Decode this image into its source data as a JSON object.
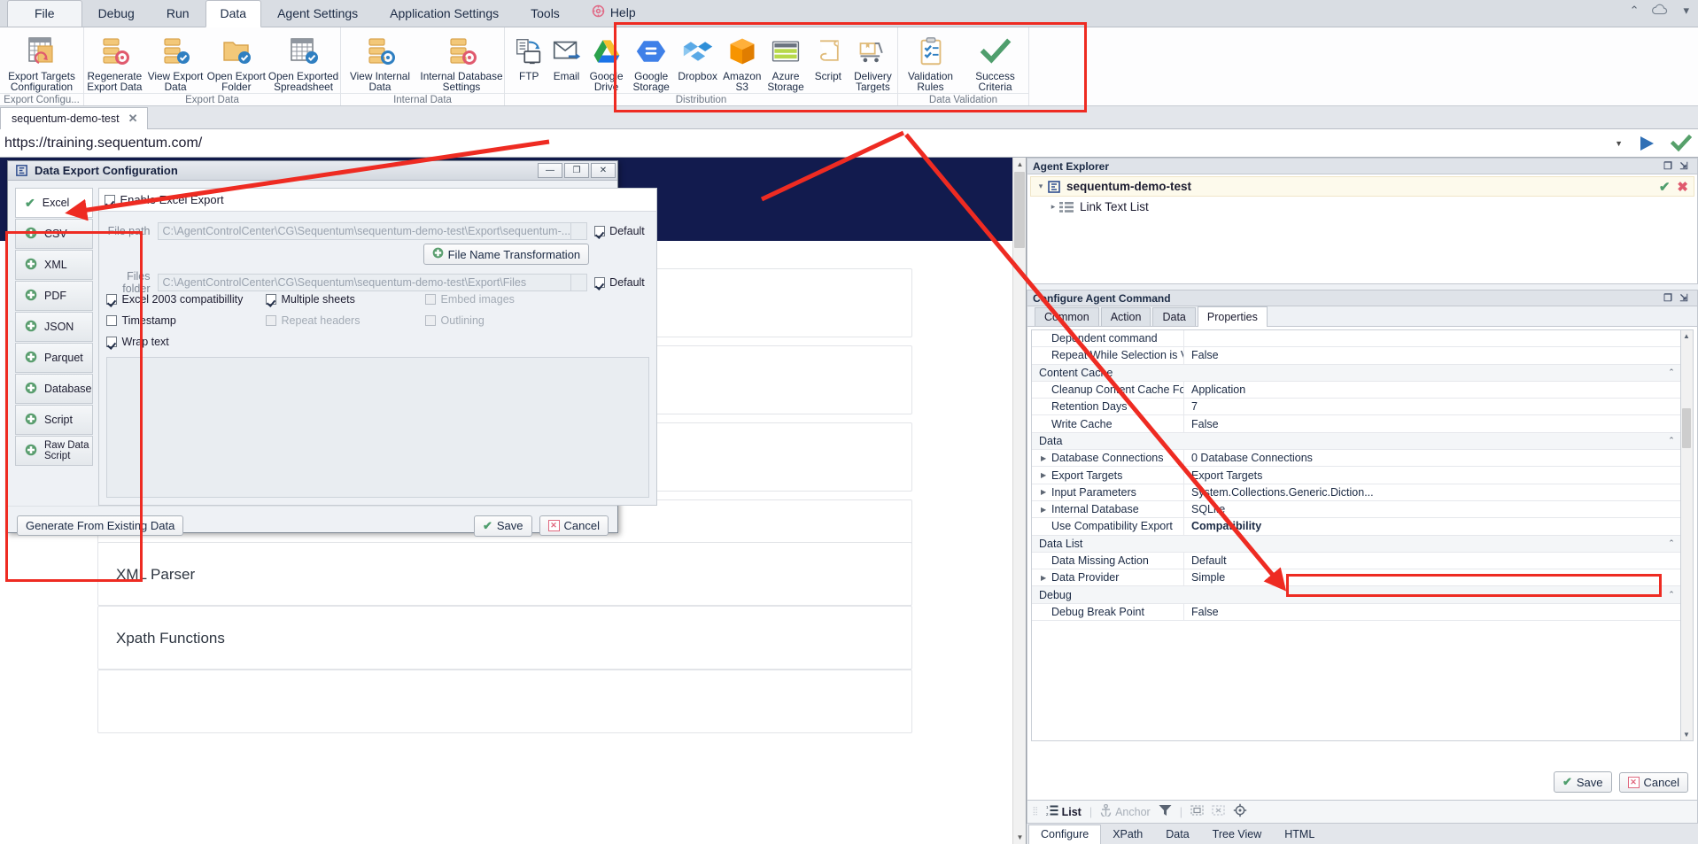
{
  "menu": {
    "items": [
      {
        "label": "File",
        "name": "menu-file"
      },
      {
        "label": "Debug",
        "name": "menu-debug"
      },
      {
        "label": "Run",
        "name": "menu-run"
      },
      {
        "label": "Data",
        "name": "menu-data"
      },
      {
        "label": "Agent Settings",
        "name": "menu-agent-settings"
      },
      {
        "label": "Application Settings",
        "name": "menu-application-settings"
      },
      {
        "label": "Tools",
        "name": "menu-tools"
      },
      {
        "label": "Help",
        "name": "menu-help"
      }
    ],
    "active": "Data"
  },
  "ribbon": {
    "groups": [
      {
        "label": "Export Configu...",
        "buttons": [
          {
            "label": "Export Targets Configuration",
            "icon": "export-targets-configuration-icon"
          }
        ]
      },
      {
        "label": "Export Data",
        "buttons": [
          {
            "label": "Regenerate Export Data",
            "icon": "regenerate-export-data-icon"
          },
          {
            "label": "View Export Data",
            "icon": "view-export-data-icon"
          },
          {
            "label": "Open Export Folder",
            "icon": "open-export-folder-icon"
          },
          {
            "label": "Open Exported Spreadsheet",
            "icon": "open-exported-spreadsheet-icon"
          }
        ]
      },
      {
        "label": "Internal Data",
        "buttons": [
          {
            "label": "View Internal Data",
            "icon": "view-internal-data-icon"
          },
          {
            "label": "Internal Database Settings",
            "icon": "internal-database-settings-icon"
          }
        ]
      },
      {
        "label": "Distribution",
        "buttons": [
          {
            "label": "FTP",
            "icon": "ftp-icon"
          },
          {
            "label": "Email",
            "icon": "email-icon"
          },
          {
            "label": "Google Drive",
            "icon": "google-drive-icon"
          },
          {
            "label": "Google Storage",
            "icon": "google-storage-icon"
          },
          {
            "label": "Dropbox",
            "icon": "dropbox-icon"
          },
          {
            "label": "Amazon S3",
            "icon": "amazon-s3-icon"
          },
          {
            "label": "Azure Storage",
            "icon": "azure-storage-icon"
          },
          {
            "label": "Script",
            "icon": "script-icon"
          },
          {
            "label": "Delivery Targets",
            "icon": "delivery-targets-icon"
          }
        ]
      },
      {
        "label": "Data Validation",
        "buttons": [
          {
            "label": "Validation Rules",
            "icon": "validation-rules-icon"
          },
          {
            "label": "Success Criteria",
            "icon": "success-criteria-icon"
          }
        ]
      }
    ]
  },
  "browser": {
    "tab_label": "sequentum-demo-test",
    "url": "https://training.sequentum.com/",
    "cards": [
      {
        "title": "XML Parser"
      },
      {
        "title": "Xpath Functions"
      }
    ]
  },
  "dialog": {
    "title": "Data Export Configuration",
    "formats": [
      {
        "label": "Excel",
        "state": "selected"
      },
      {
        "label": "CSV",
        "state": "add"
      },
      {
        "label": "XML",
        "state": "add"
      },
      {
        "label": "PDF",
        "state": "add"
      },
      {
        "label": "JSON",
        "state": "add"
      },
      {
        "label": "Parquet",
        "state": "add"
      },
      {
        "label": "Database",
        "state": "add"
      },
      {
        "label": "Script",
        "state": "add"
      },
      {
        "label": "Raw Data Script",
        "state": "add"
      }
    ],
    "enable_label": "Enable Excel Export",
    "enable_checked": true,
    "file_path_label": "File path",
    "file_path_value": "C:\\AgentControlCenter\\CG\\Sequentum\\sequentum-demo-test\\Export\\sequentum-...",
    "file_path_default_label": "Default",
    "file_name_transformation_label": "File Name Transformation",
    "files_folder_label": "Files folder",
    "files_folder_value": "C:\\AgentControlCenter\\CG\\Sequentum\\sequentum-demo-test\\Export\\Files",
    "files_folder_default_label": "Default",
    "options": [
      {
        "label": "Excel 2003 compatibillity",
        "checked": true,
        "disabled": false
      },
      {
        "label": "Timestamp",
        "checked": false,
        "disabled": false
      },
      {
        "label": "Wrap text",
        "checked": true,
        "disabled": false
      },
      {
        "label": "Multiple sheets",
        "checked": true,
        "disabled": false
      },
      {
        "label": "Repeat headers",
        "checked": false,
        "disabled": true
      },
      {
        "label": "Embed images",
        "checked": false,
        "disabled": true
      },
      {
        "label": "Outlining",
        "checked": false,
        "disabled": true
      }
    ],
    "generate_label": "Generate From Existing Data",
    "save_label": "Save",
    "cancel_label": "Cancel"
  },
  "agent_explorer": {
    "title": "Agent Explorer",
    "root": "sequentum-demo-test",
    "child": "Link Text List"
  },
  "configure_agent_command": {
    "title": "Configure Agent Command",
    "tabs": [
      "Common",
      "Action",
      "Data",
      "Properties"
    ],
    "active_tab": "Properties",
    "rows": [
      {
        "type": "prop",
        "name": "Dependent command",
        "value": "",
        "expandable": false
      },
      {
        "type": "prop",
        "name": "Repeat While Selection is Valid",
        "value": "False",
        "expandable": false
      },
      {
        "type": "category",
        "name": "Content Cache"
      },
      {
        "type": "prop",
        "name": "Cleanup Content Cache Folders",
        "value": "Application",
        "expandable": false
      },
      {
        "type": "prop",
        "name": "Retention Days",
        "value": "7",
        "expandable": false
      },
      {
        "type": "prop",
        "name": "Write Cache",
        "value": "False",
        "expandable": false
      },
      {
        "type": "category",
        "name": "Data"
      },
      {
        "type": "prop",
        "name": "Database Connections",
        "value": "0 Database Connections",
        "expandable": true
      },
      {
        "type": "prop",
        "name": "Export Targets",
        "value": "Export Targets",
        "expandable": true
      },
      {
        "type": "prop",
        "name": "Input Parameters",
        "value": "System.Collections.Generic.Diction...",
        "expandable": true
      },
      {
        "type": "prop",
        "name": "Internal Database",
        "value": "SQLite",
        "expandable": true
      },
      {
        "type": "prop",
        "name": "Use Compatibility Export",
        "value": "Compatibility",
        "expandable": false,
        "highlight": true
      },
      {
        "type": "category",
        "name": "Data List"
      },
      {
        "type": "prop",
        "name": "Data Missing Action",
        "value": "Default",
        "expandable": false
      },
      {
        "type": "prop",
        "name": "Data Provider",
        "value": "Simple",
        "expandable": true
      },
      {
        "type": "category",
        "name": "Debug"
      },
      {
        "type": "prop",
        "name": "Debug Break Point",
        "value": "False",
        "expandable": false
      }
    ],
    "save_label": "Save",
    "cancel_label": "Cancel"
  },
  "selection_toolbar": {
    "list_label": "List",
    "anchor_label": "Anchor"
  },
  "bottom_tabs": {
    "items": [
      "Configure",
      "XPath",
      "Data",
      "Tree View",
      "HTML"
    ],
    "active": "Configure"
  },
  "colors": {
    "annotation_red": "#ee2b22",
    "hero_navy": "#121b4e",
    "accent_blue": "#2f6fb5",
    "success_green": "#56a06a"
  }
}
